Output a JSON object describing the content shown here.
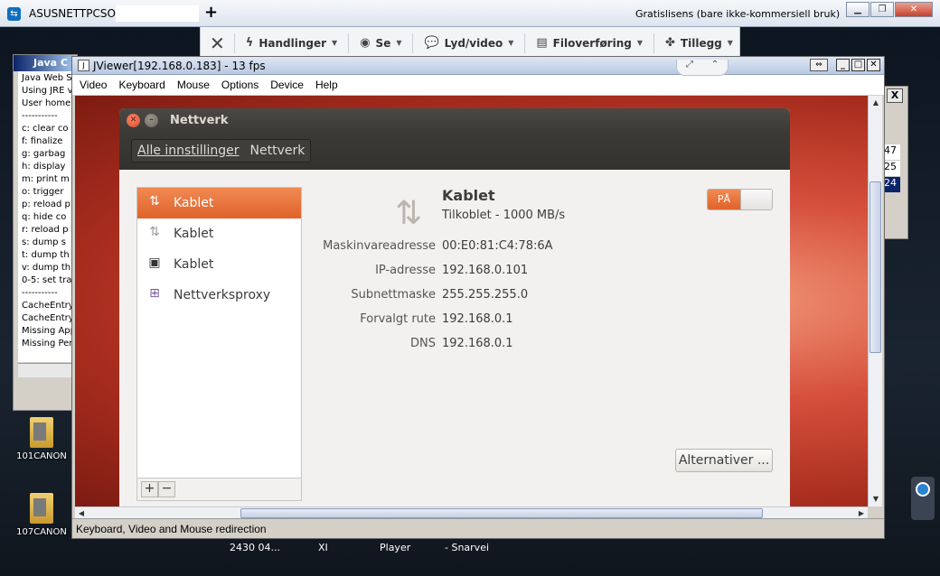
{
  "teamviewer": {
    "title": "ASUSNETTPCSOR",
    "plus": "+",
    "license": "Gratislisens (bare ikke-kommersiell bruk)",
    "toolbar": [
      {
        "label": "Handlinger",
        "icon": "lightning-icon"
      },
      {
        "label": "Se",
        "icon": "eye-icon"
      },
      {
        "label": "Lyd/video",
        "icon": "chat-icon"
      },
      {
        "label": "Filoverføring",
        "icon": "file-transfer-icon"
      },
      {
        "label": "Tillegg",
        "icon": "puzzle-icon"
      }
    ]
  },
  "desktop": {
    "icons": [
      {
        "label": "101CANON"
      },
      {
        "label": "107CANON"
      }
    ],
    "taskbar": [
      "2430 04...",
      "XI",
      "Player",
      "- Snarvei"
    ]
  },
  "java_console": {
    "title": "Java C",
    "lines": [
      "Java Web S",
      "Using JRE v",
      "User home",
      "-----------",
      "c:  clear co",
      "f:  finalize",
      "g:  garbag",
      "h:  display",
      "m:  print m",
      "o:  trigger",
      "p:  reload p",
      "q:  hide co",
      "r:  reload p",
      "s:  dump s",
      "t:  dump th",
      "v:  dump th",
      "0-5: set tra",
      "-----------",
      "CacheEntry",
      "CacheEntry",
      "Missing App",
      "Missing Per"
    ]
  },
  "right_window": {
    "close": "X",
    "cells": [
      "47",
      "25",
      "24"
    ]
  },
  "jviewer": {
    "title": "JViewer[192.168.0.183] - 13 fps",
    "menu": [
      "Video",
      "Keyboard",
      "Mouse",
      "Options",
      "Device",
      "Help"
    ],
    "status": "Keyboard, Video and Mouse redirection"
  },
  "network": {
    "title": "Nettverk",
    "breadcrumb": [
      "Alle innstillinger",
      "Nettverk"
    ],
    "items": [
      {
        "label": "Kablet",
        "icon": "wired-network-icon",
        "selected": true
      },
      {
        "label": "Kablet",
        "icon": "wired-network-icon",
        "selected": false
      },
      {
        "label": "Kablet",
        "icon": "network-device-icon",
        "selected": false
      },
      {
        "label": "Nettverksproxy",
        "icon": "proxy-icon",
        "selected": false
      }
    ],
    "add": "+",
    "remove": "−",
    "detail": {
      "name": "Kablet",
      "status": "Tilkoblet - 1000 MB/s",
      "toggle": "PÅ",
      "rows": [
        {
          "key": "Maskinvareadresse",
          "value": "00:E0:81:C4:78:6A"
        },
        {
          "key": "IP-adresse",
          "value": "192.168.0.101"
        },
        {
          "key": "Subnettmaske",
          "value": "255.255.255.0"
        },
        {
          "key": "Forvalgt rute",
          "value": "192.168.0.1"
        },
        {
          "key": "DNS",
          "value": "192.168.0.1"
        }
      ],
      "options_button": "Alternativer ..."
    }
  },
  "colors": {
    "accent": "#e0622a",
    "ubuntu_dark": "#3b3a36"
  }
}
